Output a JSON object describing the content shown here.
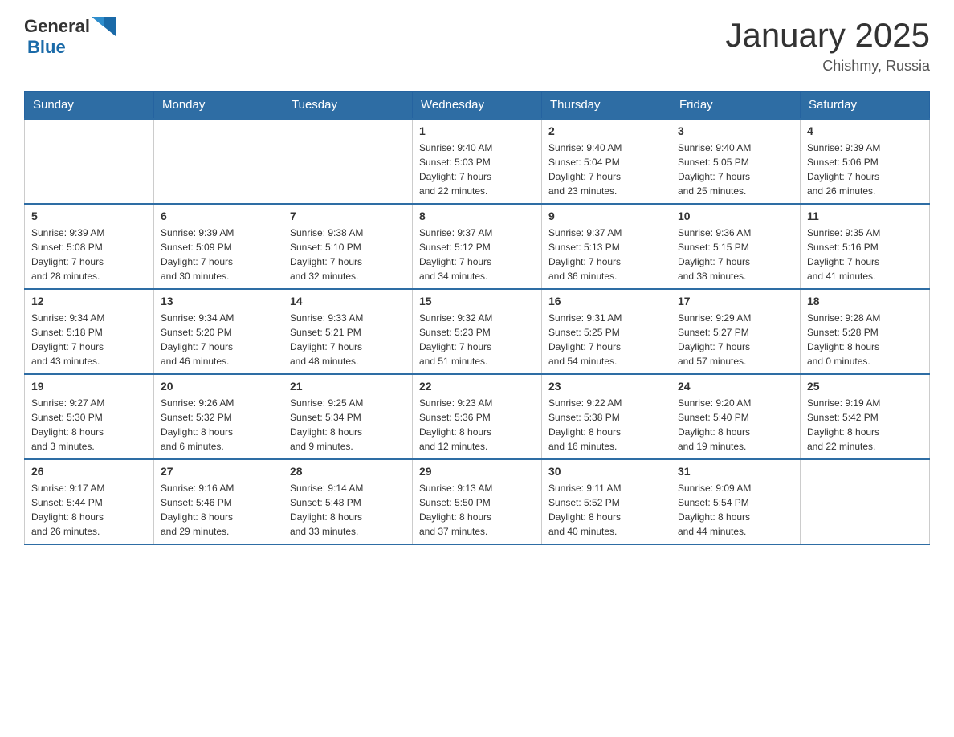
{
  "header": {
    "logo_general": "General",
    "logo_blue": "Blue",
    "title": "January 2025",
    "subtitle": "Chishmy, Russia"
  },
  "days_of_week": [
    "Sunday",
    "Monday",
    "Tuesday",
    "Wednesday",
    "Thursday",
    "Friday",
    "Saturday"
  ],
  "weeks": [
    [
      {
        "day": "",
        "info": ""
      },
      {
        "day": "",
        "info": ""
      },
      {
        "day": "",
        "info": ""
      },
      {
        "day": "1",
        "info": "Sunrise: 9:40 AM\nSunset: 5:03 PM\nDaylight: 7 hours\nand 22 minutes."
      },
      {
        "day": "2",
        "info": "Sunrise: 9:40 AM\nSunset: 5:04 PM\nDaylight: 7 hours\nand 23 minutes."
      },
      {
        "day": "3",
        "info": "Sunrise: 9:40 AM\nSunset: 5:05 PM\nDaylight: 7 hours\nand 25 minutes."
      },
      {
        "day": "4",
        "info": "Sunrise: 9:39 AM\nSunset: 5:06 PM\nDaylight: 7 hours\nand 26 minutes."
      }
    ],
    [
      {
        "day": "5",
        "info": "Sunrise: 9:39 AM\nSunset: 5:08 PM\nDaylight: 7 hours\nand 28 minutes."
      },
      {
        "day": "6",
        "info": "Sunrise: 9:39 AM\nSunset: 5:09 PM\nDaylight: 7 hours\nand 30 minutes."
      },
      {
        "day": "7",
        "info": "Sunrise: 9:38 AM\nSunset: 5:10 PM\nDaylight: 7 hours\nand 32 minutes."
      },
      {
        "day": "8",
        "info": "Sunrise: 9:37 AM\nSunset: 5:12 PM\nDaylight: 7 hours\nand 34 minutes."
      },
      {
        "day": "9",
        "info": "Sunrise: 9:37 AM\nSunset: 5:13 PM\nDaylight: 7 hours\nand 36 minutes."
      },
      {
        "day": "10",
        "info": "Sunrise: 9:36 AM\nSunset: 5:15 PM\nDaylight: 7 hours\nand 38 minutes."
      },
      {
        "day": "11",
        "info": "Sunrise: 9:35 AM\nSunset: 5:16 PM\nDaylight: 7 hours\nand 41 minutes."
      }
    ],
    [
      {
        "day": "12",
        "info": "Sunrise: 9:34 AM\nSunset: 5:18 PM\nDaylight: 7 hours\nand 43 minutes."
      },
      {
        "day": "13",
        "info": "Sunrise: 9:34 AM\nSunset: 5:20 PM\nDaylight: 7 hours\nand 46 minutes."
      },
      {
        "day": "14",
        "info": "Sunrise: 9:33 AM\nSunset: 5:21 PM\nDaylight: 7 hours\nand 48 minutes."
      },
      {
        "day": "15",
        "info": "Sunrise: 9:32 AM\nSunset: 5:23 PM\nDaylight: 7 hours\nand 51 minutes."
      },
      {
        "day": "16",
        "info": "Sunrise: 9:31 AM\nSunset: 5:25 PM\nDaylight: 7 hours\nand 54 minutes."
      },
      {
        "day": "17",
        "info": "Sunrise: 9:29 AM\nSunset: 5:27 PM\nDaylight: 7 hours\nand 57 minutes."
      },
      {
        "day": "18",
        "info": "Sunrise: 9:28 AM\nSunset: 5:28 PM\nDaylight: 8 hours\nand 0 minutes."
      }
    ],
    [
      {
        "day": "19",
        "info": "Sunrise: 9:27 AM\nSunset: 5:30 PM\nDaylight: 8 hours\nand 3 minutes."
      },
      {
        "day": "20",
        "info": "Sunrise: 9:26 AM\nSunset: 5:32 PM\nDaylight: 8 hours\nand 6 minutes."
      },
      {
        "day": "21",
        "info": "Sunrise: 9:25 AM\nSunset: 5:34 PM\nDaylight: 8 hours\nand 9 minutes."
      },
      {
        "day": "22",
        "info": "Sunrise: 9:23 AM\nSunset: 5:36 PM\nDaylight: 8 hours\nand 12 minutes."
      },
      {
        "day": "23",
        "info": "Sunrise: 9:22 AM\nSunset: 5:38 PM\nDaylight: 8 hours\nand 16 minutes."
      },
      {
        "day": "24",
        "info": "Sunrise: 9:20 AM\nSunset: 5:40 PM\nDaylight: 8 hours\nand 19 minutes."
      },
      {
        "day": "25",
        "info": "Sunrise: 9:19 AM\nSunset: 5:42 PM\nDaylight: 8 hours\nand 22 minutes."
      }
    ],
    [
      {
        "day": "26",
        "info": "Sunrise: 9:17 AM\nSunset: 5:44 PM\nDaylight: 8 hours\nand 26 minutes."
      },
      {
        "day": "27",
        "info": "Sunrise: 9:16 AM\nSunset: 5:46 PM\nDaylight: 8 hours\nand 29 minutes."
      },
      {
        "day": "28",
        "info": "Sunrise: 9:14 AM\nSunset: 5:48 PM\nDaylight: 8 hours\nand 33 minutes."
      },
      {
        "day": "29",
        "info": "Sunrise: 9:13 AM\nSunset: 5:50 PM\nDaylight: 8 hours\nand 37 minutes."
      },
      {
        "day": "30",
        "info": "Sunrise: 9:11 AM\nSunset: 5:52 PM\nDaylight: 8 hours\nand 40 minutes."
      },
      {
        "day": "31",
        "info": "Sunrise: 9:09 AM\nSunset: 5:54 PM\nDaylight: 8 hours\nand 44 minutes."
      },
      {
        "day": "",
        "info": ""
      }
    ]
  ]
}
